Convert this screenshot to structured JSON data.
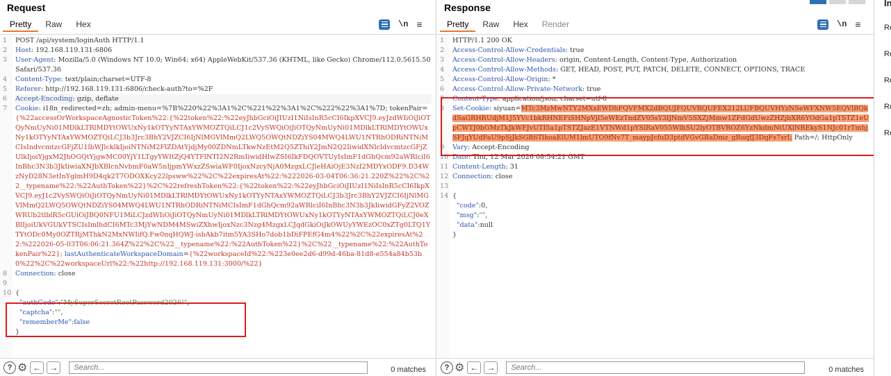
{
  "request": {
    "title": "Request",
    "tabs": [
      "Pretty",
      "Raw",
      "Hex"
    ],
    "newline_label": "\\n",
    "lines": [
      {
        "n": "1",
        "segs": [
          [
            "v",
            "POST /api/system/loginAuth HTTP/1.1"
          ]
        ]
      },
      {
        "n": "2",
        "segs": [
          [
            "k",
            "Host"
          ],
          [
            "v",
            ": 192.168.119.131:6806"
          ]
        ]
      },
      {
        "n": "3",
        "segs": [
          [
            "k",
            "User-Agent"
          ],
          [
            "v",
            ": Mozilla/5.0 (Windows NT 10.0; Win64; x64) AppleWebKit/537.36 (KHTML, like Gecko) Chrome/112.0.5615.50 Safari/537.36"
          ]
        ]
      },
      {
        "n": "4",
        "segs": [
          [
            "k",
            "Content-Type"
          ],
          [
            "v",
            ": text/plain;charset=UTF-8"
          ]
        ]
      },
      {
        "n": "5",
        "segs": [
          [
            "k",
            "Referer"
          ],
          [
            "v",
            ": http://192.168.119.131:6806/check-auth?to=%2F"
          ]
        ]
      },
      {
        "n": "6",
        "hl": true,
        "segs": [
          [
            "k",
            "Accept-Encoding"
          ],
          [
            "v",
            ": gzip, deflate"
          ]
        ]
      },
      {
        "n": "7",
        "segs": [
          [
            "k",
            "Cookie"
          ],
          [
            "v",
            ": i18n_redirected=zh; admin-menu=%7B%220%22%3A1%2C%221%22%3A1%2C%222%22%3A1%7D; tokenPair="
          ],
          [
            "r",
            "{%22accessOrWorkspaceAgnosticToken%22:{%22token%22:%22eyJhbGciOiJIUzI1NiIsInR5cCI6IkpXVCJ9.eyJzdWIiOiJiOTQyNmUyNi01MDlkLTRlMDYtOWUxNy1kOTYyNTAxYWMOZTQiLCJ1c2VySWQiOiJiOTQyNmUyNi01MDlkLTRlMDYtOWUxNy1kOTYyNTAxYWMOZTQiLCJ3b3Jrc3BhY2VJZCI6IjNlMGVlMmQ2LWQ5OWQtNDZiYS04MWQ4LWU1NTRhODRiNTNiMCIsIndvcmtzcGFjZU1lbWJlcklkIjoiNTNiM2FlZDAtYjdjMy00ZDNmLTkwNzEtM2Q5ZThiY2JmN2Q2IiwidXNlcldvcmtzcGFjZUlkIjoiYjgxM2JhOGQtYjgwMC00YjY1LTgyYWItZjQ4YTFlNTI2N2RmIiwidHlwZSI6IkFDQOVTUyIsImF1dGhQcm92aWRlciI6InBhc3N3b3JkIiwiaXNJbXBlcnNvbmF0aW5nIjpmYWxzZSwiaWF0IjoxNzcyNjA0MzgxLCJleHAiOjE3NzI2MDYxODF9.D34WzNyD28N3etInYglmH9D4qk2T7ODOXKcy22lpsww%22%2C%22expiresAt%22:%222026-03-04T06:36:21.220Z%22%2C%22__typename%22:%22AuthToken%22}%2C%22refreshToken%22:{%22token%22:%22eyJhbGciOiJIUzI1NiIsInR5cCI6IkpXVCJ9.eyJ1c2VySWQiOiJiOTQyNmUyNi01MDlkLTRlMDYtOWUxNy1kOTYyNTAxYWMOZTQiLCJ3b3Jrc3BhY2VJZCI6IjNlMGVlMmQ2LWQ5OWQtNDZiYS04MWQ4LWU1NTRhODRiNTNiMCIsImF1dGhQcm92aWRlciI6InBhc3N3b3JkIiwidGFyZ2VOZWRUb2tlblR5cGUiOiJBQ0NFU1MiLCJzdWIiOiJiOTQyNmUyNi01MDlkLTRlMDYtOWUxNy1kOTYyNTAxYWMOZTQiLCJ0eXBlIjoiUkVGUkVTSCIsImlhdCI6MTc3MjYwNDM4MSwiZXhwIjoxNzc3Nzg4MzgxLCJqdGkiOiJkOWUyYWEzOC0xZTg0LTQ1YTYtODc0My0OZTRjMThkN2MxNWIifQ.Fw0nqHQWJ-isbAkb7itm5YA3SHo7dob1bDiFPEfG4m4%22%2C%22expiresAt%22:%222026-05-03T06:06:21.364Z%22%2C%22__typename%22:%22AuthToken%22}%2C%22__typename%22:%22AuthTokenPair%22};"
          ],
          [
            "v",
            " "
          ],
          [
            "k",
            "lastAuthenticateWorkspaceDomain"
          ],
          [
            "v",
            "="
          ],
          [
            "r",
            "{%22workspaceId%22:%223e0ee2d6-d99d-46ba-81d8-e554a84b53b0%22%2C%22workspaceUrl%22:%22http://192.168.119.131:3000/%22}"
          ]
        ]
      },
      {
        "n": "8",
        "segs": [
          [
            "k",
            "Connection"
          ],
          [
            "v",
            ": close"
          ]
        ]
      },
      {
        "n": "9",
        "segs": [
          [
            "v",
            ""
          ]
        ]
      },
      {
        "n": "10",
        "segs": [
          [
            "v",
            "{"
          ]
        ]
      },
      {
        "n": "",
        "segs": [
          [
            "v",
            "  "
          ],
          [
            "js",
            "\"authCode\""
          ],
          [
            "v",
            ":"
          ],
          [
            "jv",
            "\"MySuperSecretRootPassword2026!\""
          ],
          [
            "v",
            ","
          ]
        ]
      },
      {
        "n": "",
        "segs": [
          [
            "v",
            "  "
          ],
          [
            "js",
            "\"captcha\""
          ],
          [
            "v",
            ":"
          ],
          [
            "jv",
            "\"\""
          ],
          [
            "v",
            ","
          ]
        ]
      },
      {
        "n": "",
        "segs": [
          [
            "v",
            "  "
          ],
          [
            "js",
            "\"rememberMe\""
          ],
          [
            "v",
            ":"
          ],
          [
            "js",
            "false"
          ]
        ]
      },
      {
        "n": "",
        "segs": [
          [
            "v",
            "}"
          ]
        ]
      }
    ],
    "search_placeholder": "Search...",
    "matches": "0 matches"
  },
  "response": {
    "title": "Response",
    "tabs": [
      "Pretty",
      "Raw",
      "Hex",
      "Render"
    ],
    "newline_label": "\\n",
    "lines": [
      {
        "n": "1",
        "segs": [
          [
            "v",
            "HTTP/1.1 200 OK"
          ]
        ]
      },
      {
        "n": "2",
        "segs": [
          [
            "k",
            "Access-Control-Allow-Credentials"
          ],
          [
            "v",
            ": true"
          ]
        ]
      },
      {
        "n": "3",
        "segs": [
          [
            "k",
            "Access-Control-Allow-Headers"
          ],
          [
            "v",
            ": origin, Content-Length, Content-Type, Authorization"
          ]
        ]
      },
      {
        "n": "4",
        "segs": [
          [
            "k",
            "Access-Control-Allow-Methods"
          ],
          [
            "v",
            ": GET, HEAD, POST, PUT, PATCH, DELETE, CONNECT, OPTIONS, TRACE"
          ]
        ]
      },
      {
        "n": "5",
        "segs": [
          [
            "k",
            "Access-Control-Allow-Origin"
          ],
          [
            "v",
            ": *"
          ]
        ]
      },
      {
        "n": "6",
        "segs": [
          [
            "k",
            "Access-Control-Allow-Private-Network"
          ],
          [
            "v",
            ": true"
          ]
        ]
      },
      {
        "n": "7",
        "segs": [
          [
            "k",
            "Content-Type"
          ],
          [
            "v",
            ": application/json; charset=utf-8"
          ]
        ]
      },
      {
        "n": "8",
        "segs": [
          [
            "k",
            "Set-Cookie"
          ],
          [
            "v",
            ": siyuan="
          ],
          [
            "sc",
            "MTc3MzMwNTY2MXxEWDhFQVFMX2dBQUJFQUVRQUFEX212LUFBQUVHYzNSeWFXNW5EQVlBQkdSaGRHRUdjM1J5YVc1bkRHNEFiSHNpVjI5eWEzTndZV05sY3lJNmV5SXZjMmw1ZFdGdUwzZHZjbXR6YOdGa1pTSTZ1eUpCWTJ0bGMzTkJkWFJvUTI5a1pTSTZJazE1VTNWd1pYSlRaV055WlhSU2lyOTBVROZ6YzNkdmNtUXlNREkyS1NJc01rTmhjSFJqYUdFaU9pSjJkSGR6TlhoaElUM1lmUTO9fNv7T_maypJcfuD3ptdVGvGBaDmz_gRuqfJ3DqFs7srI;"
          ],
          [
            "v",
            " Path=/; HttpOnly"
          ]
        ]
      },
      {
        "n": "9",
        "segs": [
          [
            "k",
            "Vary"
          ],
          [
            "v",
            ": Accept-Encoding"
          ]
        ]
      },
      {
        "n": "10",
        "segs": [
          [
            "k",
            "Date"
          ],
          [
            "v",
            ": Thu, 12 Mar 2026 08:54:21 GMT"
          ]
        ]
      },
      {
        "n": "11",
        "segs": [
          [
            "k",
            "Content-Length"
          ],
          [
            "v",
            ": 31"
          ]
        ]
      },
      {
        "n": "12",
        "segs": [
          [
            "k",
            "Connection"
          ],
          [
            "v",
            ": close"
          ]
        ]
      },
      {
        "n": "13",
        "segs": [
          [
            "v",
            ""
          ]
        ]
      },
      {
        "n": "14",
        "segs": [
          [
            "v",
            "{"
          ]
        ]
      },
      {
        "n": "",
        "segs": [
          [
            "v",
            "  "
          ],
          [
            "js",
            "\"code\""
          ],
          [
            "v",
            ":0,"
          ]
        ]
      },
      {
        "n": "",
        "segs": [
          [
            "v",
            "  "
          ],
          [
            "js",
            "\"msg\""
          ],
          [
            "v",
            ":"
          ],
          [
            "jv",
            "\"\""
          ],
          [
            "v",
            ","
          ]
        ]
      },
      {
        "n": "",
        "segs": [
          [
            "v",
            "  "
          ],
          [
            "js",
            "\"data\""
          ],
          [
            "v",
            ":null"
          ]
        ]
      },
      {
        "n": "",
        "segs": [
          [
            "v",
            "}"
          ]
        ]
      }
    ],
    "search_placeholder": "Search...",
    "matches": "0 matches"
  },
  "inspector": {
    "title_partial": "In",
    "items": [
      "Re",
      "Re",
      "Re",
      "Re",
      "Re"
    ]
  },
  "colors": {
    "accent": "#e8772e",
    "highlight_box": "#d81e1e",
    "header_key": "#2e56b0",
    "cookie_value": "#c0392b",
    "set_cookie_bg": "#f4a178"
  },
  "icons": {
    "wrap": "wrap-lines-icon",
    "menu": "hamburger-menu-icon",
    "help": "help-icon",
    "settings": "gear-icon",
    "back": "arrow-left-icon",
    "forward": "arrow-right-icon"
  }
}
